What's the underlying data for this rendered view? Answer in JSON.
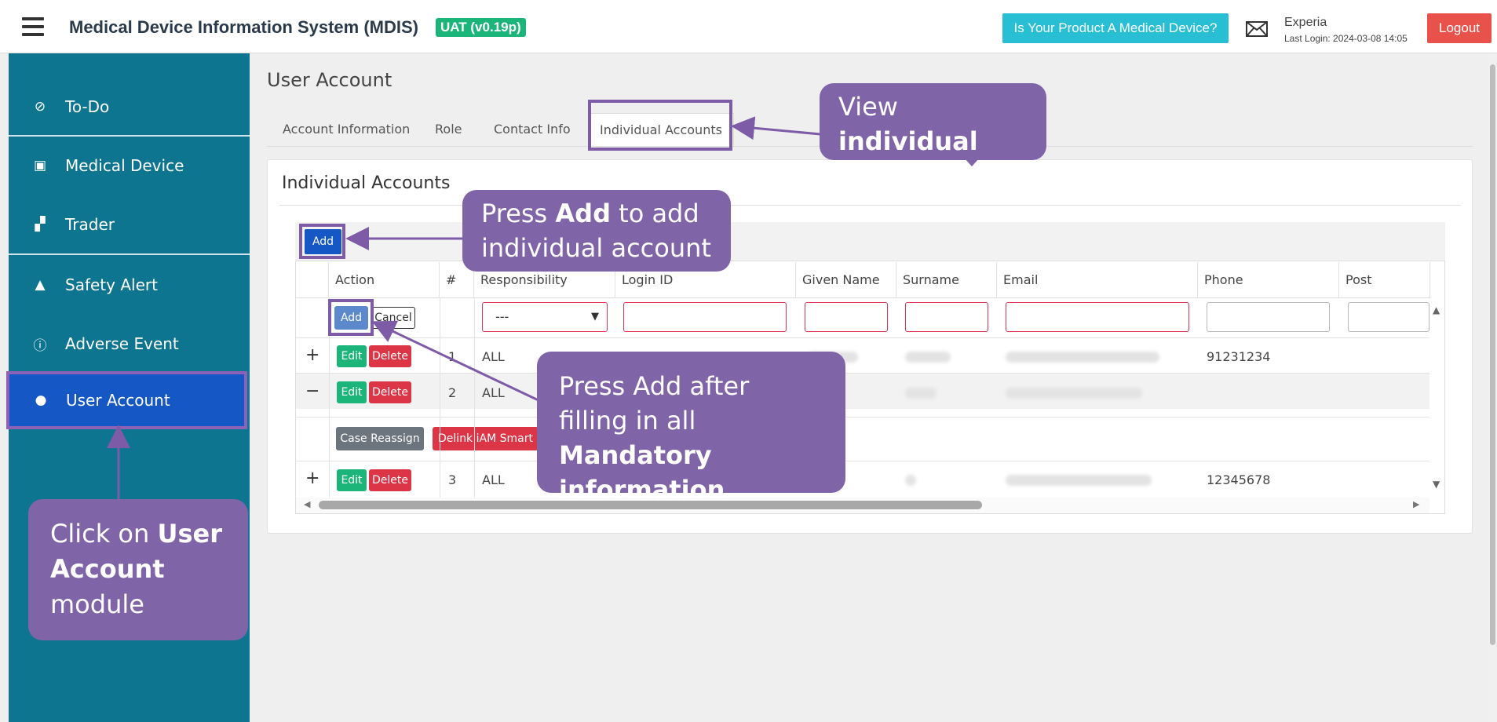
{
  "header": {
    "app_title": "Medical Device Information System (MDIS)",
    "env_badge": "UAT (v0.19p)",
    "product_check_label": "Is Your Product A Medical Device?",
    "user_name": "Experia",
    "last_login": "Last Login: 2024-03-08 14:05",
    "logout_label": "Logout",
    "icons": [
      "menu-icon",
      "mail-icon"
    ]
  },
  "sidebar": {
    "items": [
      {
        "label": "To-Do",
        "icon": "check-circle-icon",
        "glyph": "⊘"
      },
      {
        "label": "Medical Device",
        "icon": "printer-icon",
        "glyph": "▣"
      },
      {
        "label": "Trader",
        "icon": "people-icon",
        "glyph": "▞"
      },
      {
        "label": "Safety Alert",
        "icon": "bell-icon",
        "glyph": "▲"
      },
      {
        "label": "Adverse Event",
        "icon": "info-circle-icon",
        "glyph": "ⓘ"
      },
      {
        "label": "User Account",
        "icon": "user-icon",
        "glyph": "●"
      }
    ],
    "active": "User Account"
  },
  "main": {
    "page_title": "User Account",
    "tabs": [
      "Account Information",
      "Role",
      "Contact Info",
      "Individual Accounts"
    ],
    "active_tab": "Individual Accounts",
    "card_title": "Individual Accounts",
    "add_label": "Add",
    "columns": [
      "Action",
      "#",
      "Responsibility",
      "Login ID",
      "Given Name",
      "Surname",
      "Email",
      "Phone",
      "Post"
    ],
    "new_row": {
      "add_label": "Add",
      "cancel_label": "Cancel",
      "responsibility_value": "---",
      "login_id": "",
      "given_name": "",
      "surname": "",
      "email": "",
      "phone": "",
      "post": ""
    },
    "rows": [
      {
        "expander": "+",
        "edit": "Edit",
        "delete": "Delete",
        "num": "1",
        "responsibility": "ALL",
        "phone": "91231234"
      },
      {
        "expander": "−",
        "edit": "Edit",
        "delete": "Delete",
        "num": "2",
        "responsibility": "ALL",
        "phone": ""
      },
      {
        "expander": "+",
        "edit": "Edit",
        "delete": "Delete",
        "num": "3",
        "responsibility": "ALL",
        "phone": "12345678"
      }
    ],
    "detail_actions": {
      "reassign": "Case Reassign",
      "delink": "Delink iAM Smart"
    }
  },
  "annotations": {
    "view_accounts": {
      "pre": "View ",
      "bold": "individual accounts"
    },
    "press_add": {
      "pre": "Press ",
      "bold": "Add",
      "post": " to add individual account"
    },
    "press_add_after": {
      "pre": "Press Add after filling in all ",
      "bold": "Mandatory information"
    },
    "click_module": {
      "pre": "Click on ",
      "bold": "User Account",
      "post": " module"
    },
    "color": "#8064a8"
  },
  "colors": {
    "sidebar": "#0e7590",
    "active_nav": "#1557c4",
    "accent_cyan": "#28bed4",
    "logout": "#e9524a",
    "badge": "#1bb57a"
  }
}
